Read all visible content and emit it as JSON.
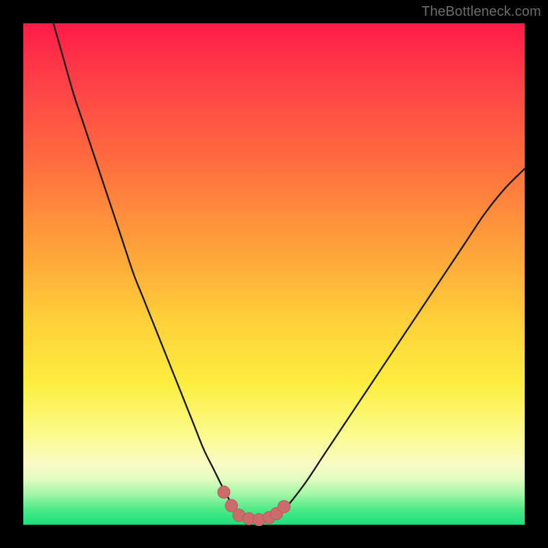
{
  "watermark": {
    "text": "TheBottleneck.com"
  },
  "colors": {
    "page_bg": "#000000",
    "curve_stroke": "#1a1a1a",
    "marker_fill": "#CC6B6B",
    "marker_stroke": "#B85A5A"
  },
  "chart_data": {
    "type": "line",
    "title": "",
    "xlabel": "",
    "ylabel": "",
    "xlim": [
      0,
      100
    ],
    "ylim": [
      0,
      100
    ],
    "grid": false,
    "legend": false,
    "series": [
      {
        "name": "bottleneck-curve",
        "x": [
          6,
          8,
          10,
          12,
          14,
          16,
          18,
          20,
          22,
          24,
          26,
          28,
          30,
          32,
          34,
          36,
          38,
          40,
          42,
          44,
          46,
          48,
          50,
          52,
          56,
          60,
          64,
          68,
          72,
          76,
          80,
          84,
          88,
          92,
          96,
          100
        ],
        "y": [
          100,
          93,
          86,
          80,
          74,
          68,
          62,
          56,
          50,
          45,
          40,
          35,
          30,
          25,
          20,
          15,
          11,
          7,
          3.5,
          1.8,
          1.2,
          1.0,
          1.5,
          3,
          8,
          14,
          20,
          26,
          32,
          38,
          44,
          50,
          56,
          62,
          67,
          71
        ]
      }
    ],
    "markers": {
      "name": "optimal-range-markers",
      "x": [
        40,
        41.5,
        43,
        45,
        47,
        49,
        50.5,
        52
      ],
      "y": [
        6.5,
        3.8,
        1.9,
        1.2,
        1.0,
        1.4,
        2.2,
        3.6
      ]
    }
  }
}
